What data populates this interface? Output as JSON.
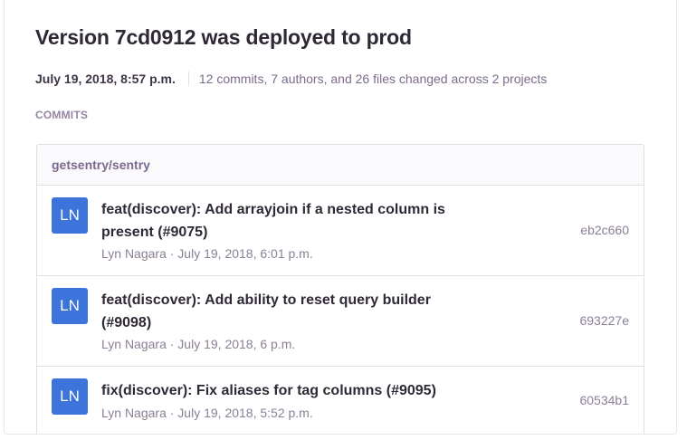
{
  "release": {
    "title": "Version 7cd0912 was deployed to prod",
    "date": "July 19, 2018, 8:57 p.m.",
    "summary": "12 commits, 7 authors, and 26 files changed across 2 projects"
  },
  "commits_section": {
    "label": "COMMITS",
    "repo": "getsentry/sentry",
    "items": [
      {
        "initials": "LN",
        "message": "feat(discover): Add arrayjoin if a nested column is present (#9075)",
        "author_line": "Lyn Nagara · July 19, 2018, 6:01 p.m.",
        "sha": "eb2c660"
      },
      {
        "initials": "LN",
        "message": "feat(discover): Add ability to reset query builder (#9098)",
        "author_line": "Lyn Nagara · July 19, 2018, 6 p.m.",
        "sha": "693227e"
      },
      {
        "initials": "LN",
        "message": "fix(discover): Fix aliases for tag columns (#9095)",
        "author_line": "Lyn Nagara · July 19, 2018, 5:52 p.m.",
        "sha": "60534b1"
      }
    ]
  },
  "colors": {
    "avatar_bg": "#3d74db",
    "title_text": "#2f2936",
    "muted_text": "#8b7f96"
  }
}
